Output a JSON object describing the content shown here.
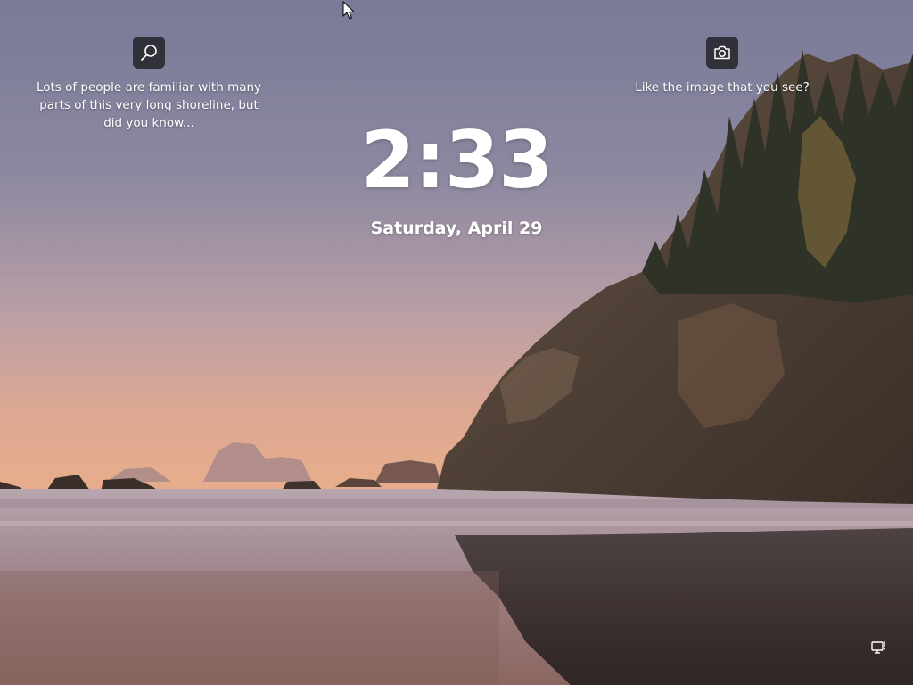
{
  "lock_screen": {
    "time": "2:33",
    "date": "Saturday, April 29"
  },
  "widgets": {
    "learn_more": {
      "icon": "search-icon",
      "text": "Lots of people are familiar with many parts of this very long shoreline, but did you know..."
    },
    "like_image": {
      "icon": "camera-icon",
      "text": "Like the image that you see?"
    }
  },
  "status": {
    "network_icon": "network-icon"
  },
  "colors": {
    "sky_top": "#7b7c9a",
    "sky_horizon": "#e3a98a",
    "widget_bg": "#202024",
    "text": "#ffffff"
  }
}
